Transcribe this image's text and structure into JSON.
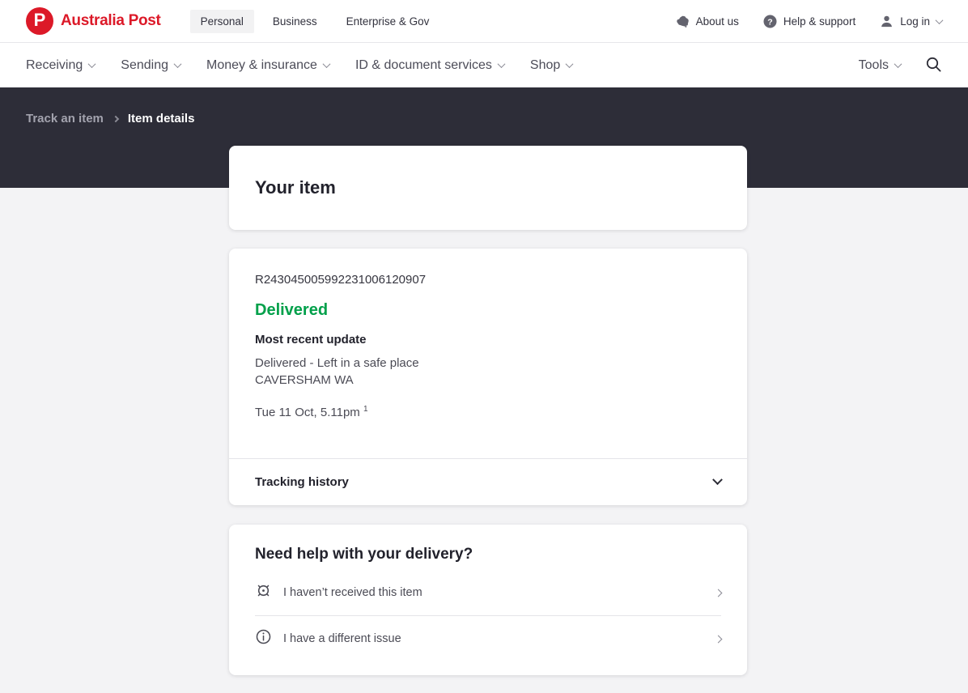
{
  "colors": {
    "brand_red": "#dc1928",
    "status_green": "#00a04a",
    "dark_band": "#2d2d38",
    "page_bg": "#f3f3f5"
  },
  "header": {
    "brand": "Australia Post",
    "logo_letter": "P",
    "audience_tabs": [
      {
        "label": "Personal",
        "selected": true
      },
      {
        "label": "Business",
        "selected": false
      },
      {
        "label": "Enterprise & Gov",
        "selected": false
      }
    ],
    "links": [
      {
        "label": "About us",
        "icon": "australia-map-icon"
      },
      {
        "label": "Help & support",
        "icon": "help-icon"
      },
      {
        "label": "Log in",
        "icon": "user-icon"
      }
    ]
  },
  "nav": {
    "items": [
      "Receiving",
      "Sending",
      "Money & insurance",
      "ID & document services",
      "Shop"
    ],
    "tools_label": "Tools",
    "search_icon": "search-icon"
  },
  "breadcrumb": {
    "parent": "Track an item",
    "current": "Item details"
  },
  "your_item": {
    "title": "Your item"
  },
  "tracking": {
    "id": "R243045005992231006120907",
    "status": "Delivered",
    "recent_update_heading": "Most recent update",
    "update_line1": "Delivered - Left in a safe place",
    "update_line2": "CAVERSHAM WA",
    "update_time": "Tue 11 Oct, 5.11pm",
    "update_time_superscript": "1",
    "history_label": "Tracking history"
  },
  "help": {
    "title": "Need help with your delivery?",
    "items": [
      {
        "label": "I haven’t received this item",
        "icon": "target-icon"
      },
      {
        "label": "I have a different issue",
        "icon": "info-icon"
      }
    ]
  }
}
